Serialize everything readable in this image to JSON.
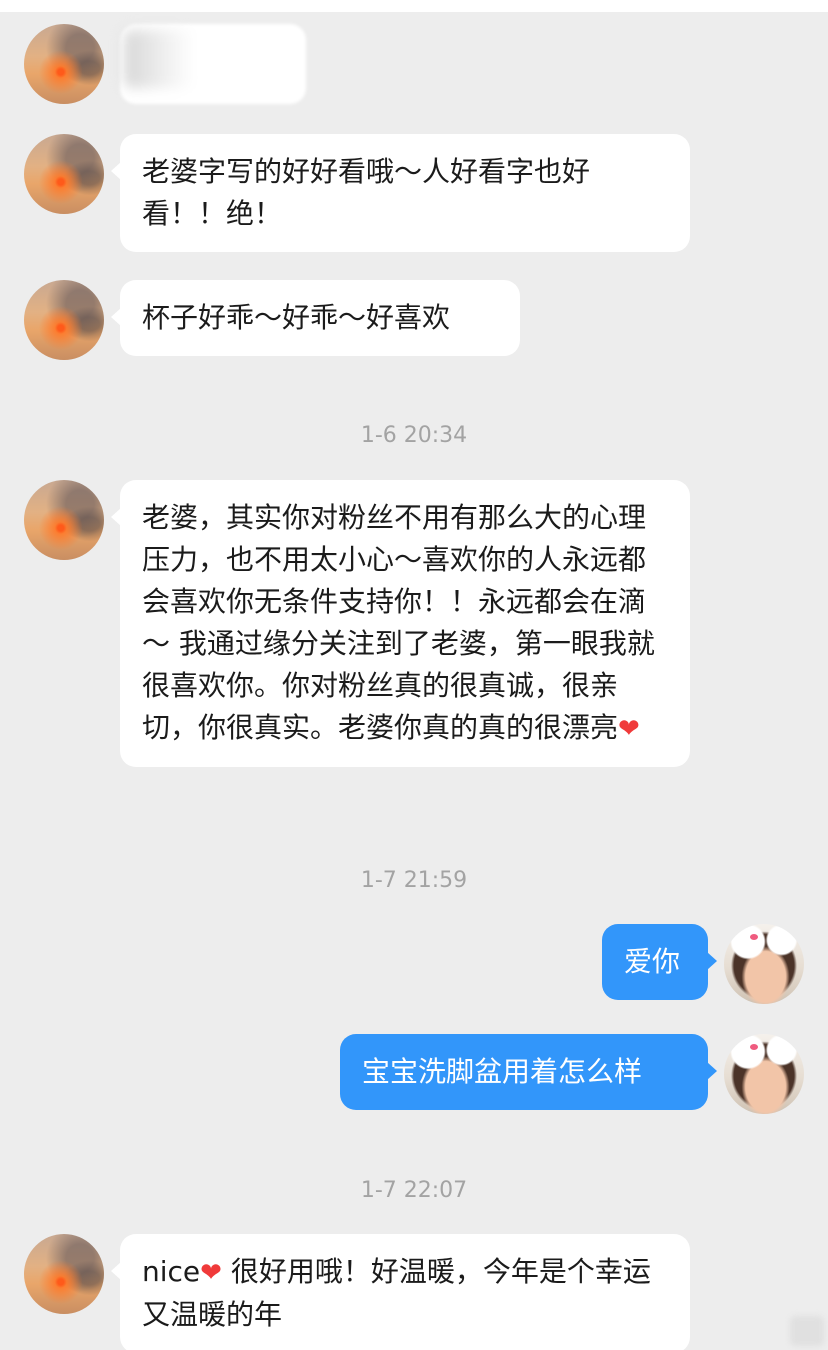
{
  "colors": {
    "background": "#ededed",
    "incoming_bubble": "#ffffff",
    "outgoing_bubble": "#3296fa",
    "timestamp": "#a3a3a3",
    "heart": "#f03a3a"
  },
  "messages": [
    {
      "type": "incoming",
      "text": "",
      "note": ""
    },
    {
      "type": "incoming",
      "text": "老婆字写的好好看哦～人好看字也好看！！绝！"
    },
    {
      "type": "incoming",
      "text": "杯子好乖～好乖～好喜欢"
    },
    {
      "type": "timestamp",
      "text": "1-6 20:34"
    },
    {
      "type": "incoming",
      "text": "老婆，其实你对粉丝不用有那么大的心理压力，也不用太小心～喜欢你的人永远都会喜欢你无条件支持你！！永远都会在滴～  我通过缘分关注到了老婆，第一眼我就很喜欢你。你对粉丝真的很真诚，很亲切，你很真实。老婆你真的真的很漂亮",
      "suffix_icon": "heart-icon"
    },
    {
      "type": "timestamp",
      "text": "1-7 21:59"
    },
    {
      "type": "outgoing",
      "text": "爱你"
    },
    {
      "type": "outgoing",
      "text": "宝宝洗脚盆用着怎么样"
    },
    {
      "type": "timestamp",
      "text": "1-7 22:07"
    },
    {
      "type": "incoming",
      "text_before_icon": "nice",
      "text_after_icon": " 很好用哦！好温暖，今年是个幸运又温暖的年",
      "inline_icon": "heart-icon"
    }
  ],
  "icons": {
    "heart": "❤"
  }
}
